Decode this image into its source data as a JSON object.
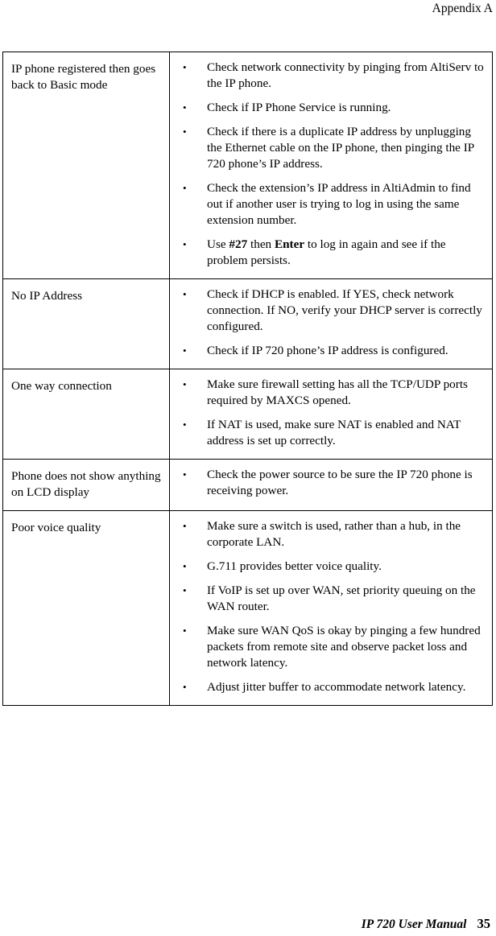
{
  "header": {
    "running_head": "Appendix A"
  },
  "footer": {
    "manual_title": "IP 720 User Manual",
    "page_number": "35"
  },
  "table": {
    "rows": [
      {
        "symptom": "IP phone registered then goes back to Basic mode",
        "items": [
          {
            "text": "Check network connectivity by pinging from AltiServ to the IP phone."
          },
          {
            "text": "Check if IP Phone Service is running."
          },
          {
            "text": "Check if there is a duplicate IP address by unplugging the Ethernet cable on the IP phone, then pinging the IP 720 phone’s IP address."
          },
          {
            "text": "Check the extension’s IP address in AltiAdmin to find out if another user is trying to log in using the same extension number."
          },
          {
            "segments": [
              {
                "text": "Use ",
                "bold": false
              },
              {
                "text": "#27",
                "bold": true
              },
              {
                "text": " then ",
                "bold": false
              },
              {
                "text": "Enter",
                "bold": true
              },
              {
                "text": " to log in again and see if the problem persists.",
                "bold": false
              }
            ]
          }
        ]
      },
      {
        "symptom": "No IP Address",
        "items": [
          {
            "text": "Check if DHCP is enabled. If YES, check network connection. If NO, verify your DHCP server is correctly configured."
          },
          {
            "text": "Check if IP 720 phone’s IP address is configured."
          }
        ]
      },
      {
        "symptom": "One way connection",
        "items": [
          {
            "text": "Make sure firewall setting has all the TCP/UDP ports required by MAXCS opened."
          },
          {
            "text": "If NAT is used, make sure NAT is enabled and NAT address is set up correctly."
          }
        ]
      },
      {
        "symptom": "Phone does not show anything on LCD display",
        "items": [
          {
            "text": "Check the power source to be sure the IP 720 phone is receiving power."
          }
        ]
      },
      {
        "symptom": "Poor voice quality",
        "items": [
          {
            "text": "Make sure a switch is used, rather than a hub, in the corporate LAN."
          },
          {
            "text": "G.711 provides better voice quality."
          },
          {
            "text": "If VoIP is set up over WAN, set priority queuing on the WAN router."
          },
          {
            "text": "Make sure WAN QoS is okay by pinging a few hundred packets from remote site and observe packet loss and network latency."
          },
          {
            "text": "Adjust jitter buffer to accommodate network latency."
          }
        ]
      }
    ],
    "bullet_glyph": "•"
  }
}
